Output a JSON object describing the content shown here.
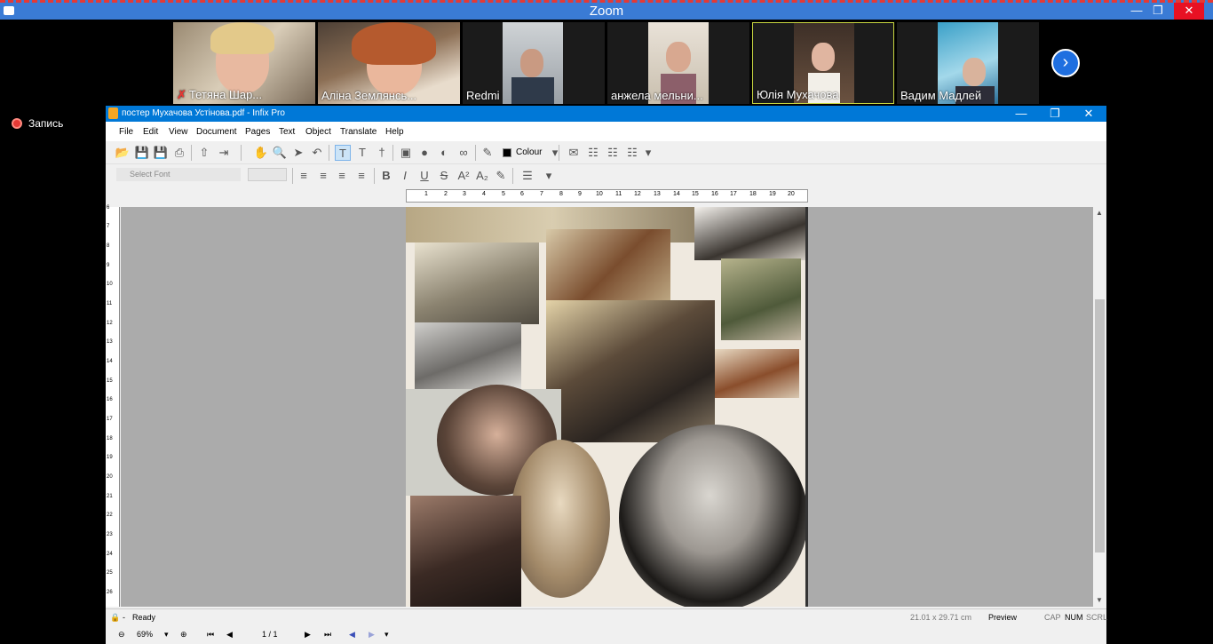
{
  "zoom": {
    "title": "Zoom",
    "recording_label": "Запись",
    "participants": [
      {
        "name": "Тетяна Шар...",
        "muted": true
      },
      {
        "name": "Аліна Землянсь...",
        "muted": false
      },
      {
        "name": "Redmi",
        "muted": false
      },
      {
        "name": "анжела мельни...",
        "muted": false
      },
      {
        "name": "Юлія Мухачова",
        "muted": false,
        "active": true
      },
      {
        "name": "Вадим Мадлей",
        "muted": false
      }
    ],
    "next_icon": "chevron-right-icon"
  },
  "infix": {
    "title": "постер Мухачова Устінова.pdf - Infix Pro",
    "menu": [
      "File",
      "Edit",
      "View",
      "Document",
      "Pages",
      "Text",
      "Object",
      "Translate",
      "Help"
    ],
    "colour_label": "Colour",
    "font_placeholder": "Select Font",
    "ruler_top": [
      "1",
      "2",
      "3",
      "4",
      "5",
      "6",
      "7",
      "8",
      "9",
      "10",
      "11",
      "12",
      "13",
      "14",
      "15",
      "16",
      "17",
      "18",
      "19",
      "20"
    ],
    "ruler_left": [
      "6",
      "7",
      "8",
      "9",
      "10",
      "11",
      "12",
      "13",
      "14",
      "15",
      "16",
      "17",
      "18",
      "19",
      "20",
      "21",
      "22",
      "23",
      "24",
      "25",
      "26"
    ],
    "status": {
      "ready": "Ready",
      "dash": "-",
      "page_size": "21.01 x 29.71 cm",
      "mode": "Preview",
      "cap": "CAP",
      "num": "NUM",
      "scrl": "SCRL"
    },
    "nav": {
      "zoom": "69%",
      "page": "1 / 1"
    }
  }
}
